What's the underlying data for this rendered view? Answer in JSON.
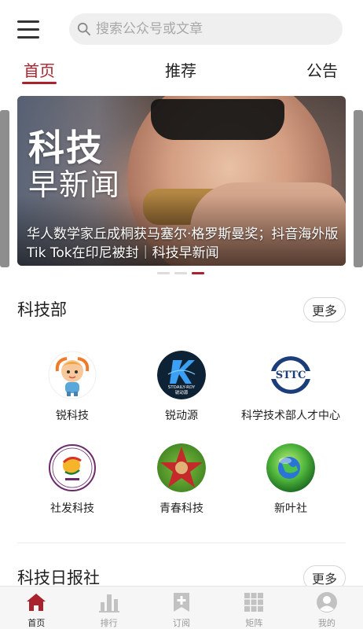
{
  "search": {
    "placeholder": "搜索公众号或文章"
  },
  "tabs": [
    {
      "label": "首页",
      "active": true
    },
    {
      "label": "推荐",
      "active": false
    },
    {
      "label": "公告",
      "active": false
    }
  ],
  "banner": {
    "logo_line1": "科技",
    "logo_line2": "早新闻",
    "caption": "华人数学家丘成桐获马塞尔·格罗斯曼奖；抖音海外版Tik Tok在印尼被封｜科技早新闻",
    "slide_count": 3,
    "active_slide": 3
  },
  "section1": {
    "title": "科技部",
    "more_label": "更多",
    "items": [
      {
        "name": "锐科技",
        "icon": "cartoon-kid-avatar"
      },
      {
        "name": "锐动源",
        "icon": "k-logo",
        "logo_text1": "STDAILY-RDY",
        "logo_text2": "锐动源"
      },
      {
        "name": "科学技术部人才中心",
        "icon": "sttc-logo",
        "logo_text": "STTC"
      },
      {
        "name": "社发科技",
        "icon": "seal-logo"
      },
      {
        "name": "青春科技",
        "icon": "star-logo"
      },
      {
        "name": "新叶社",
        "icon": "globe-logo"
      }
    ]
  },
  "section2": {
    "title": "科技日报社",
    "more_label": "更多"
  },
  "bottom_nav": [
    {
      "label": "首页",
      "icon": "home-icon",
      "active": true
    },
    {
      "label": "排行",
      "icon": "bar-chart-icon",
      "active": false
    },
    {
      "label": "订阅",
      "icon": "bookmark-plus-icon",
      "active": false
    },
    {
      "label": "矩阵",
      "icon": "grid-icon",
      "active": false
    },
    {
      "label": "我的",
      "icon": "user-icon",
      "active": false
    }
  ],
  "colors": {
    "accent": "#a8232d",
    "inactive_icon": "#c2c2c2"
  }
}
